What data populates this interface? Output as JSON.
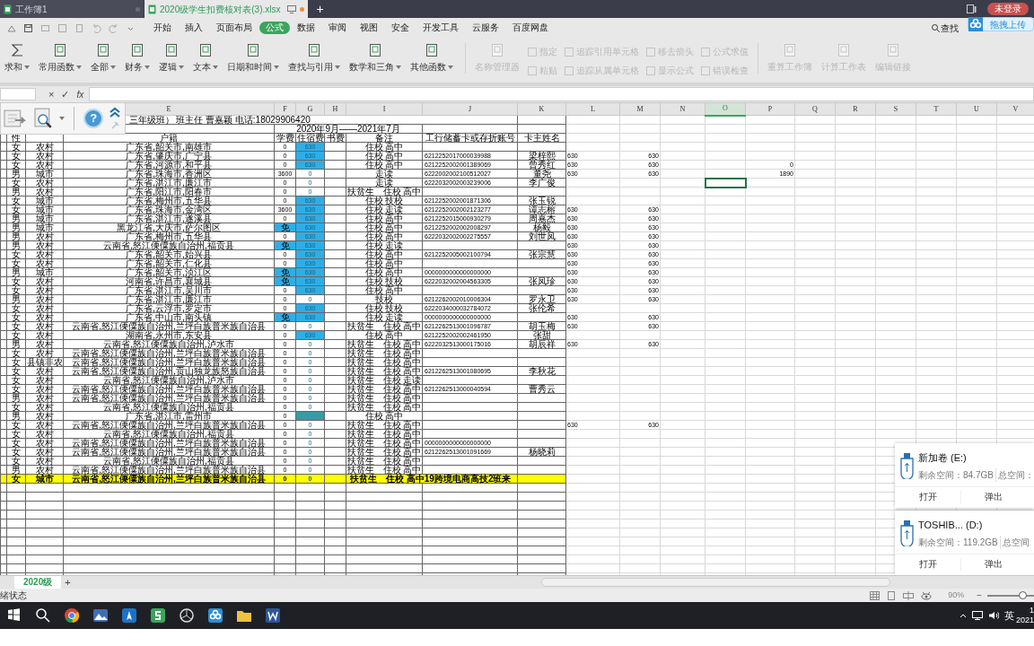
{
  "title_bar": {
    "tabs": [
      {
        "label": "工作簿1",
        "selected": false
      },
      {
        "label": "2020级学生扣费核对表(3).xlsx",
        "selected": true
      }
    ],
    "new_tab": "+",
    "login": "未登录"
  },
  "upload_tip": "拖拽上传",
  "menu": [
    {
      "label": "开始",
      "selected": false
    },
    {
      "label": "插入",
      "selected": false
    },
    {
      "label": "页面布局",
      "selected": false
    },
    {
      "label": "公式",
      "selected": true
    },
    {
      "label": "数据",
      "selected": false
    },
    {
      "label": "审阅",
      "selected": false
    },
    {
      "label": "视图",
      "selected": false
    },
    {
      "label": "安全",
      "selected": false
    },
    {
      "label": "开发工具",
      "selected": false
    },
    {
      "label": "云服务",
      "selected": false
    },
    {
      "label": "百度网盘",
      "selected": false
    }
  ],
  "search": "查找",
  "ribbon": [
    {
      "kind": "big",
      "label": "求和",
      "disabled": false,
      "dropdown": true
    },
    {
      "kind": "big",
      "label": "常用函数",
      "disabled": false,
      "dropdown": true
    },
    {
      "kind": "big",
      "label": "全部",
      "disabled": false,
      "dropdown": true
    },
    {
      "kind": "big",
      "label": "财务",
      "disabled": false,
      "dropdown": true
    },
    {
      "kind": "big",
      "label": "逻辑",
      "disabled": false,
      "dropdown": true
    },
    {
      "kind": "big",
      "label": "文本",
      "disabled": false,
      "dropdown": true
    },
    {
      "kind": "big",
      "label": "日期和时间",
      "disabled": false,
      "dropdown": true
    },
    {
      "kind": "big",
      "label": "查找与引用",
      "disabled": false,
      "dropdown": true
    },
    {
      "kind": "big",
      "label": "数学和三角",
      "disabled": false,
      "dropdown": true
    },
    {
      "kind": "big",
      "label": "其他函数",
      "disabled": false,
      "dropdown": true
    },
    {
      "kind": "big",
      "label": "名称管理器",
      "disabled": true,
      "dropdown": false
    },
    {
      "kind": "stack",
      "items": [
        {
          "label": "指定",
          "disabled": true
        },
        {
          "label": "粘贴",
          "disabled": true
        }
      ]
    },
    {
      "kind": "stack",
      "items": [
        {
          "label": "追踪引用单元格",
          "disabled": true
        },
        {
          "label": "追踪从属单元格",
          "disabled": true
        }
      ]
    },
    {
      "kind": "stack",
      "items": [
        {
          "label": "移去箭头",
          "disabled": true
        },
        {
          "label": "显示公式",
          "disabled": true
        }
      ]
    },
    {
      "kind": "stack",
      "items": [
        {
          "label": "公式求值",
          "disabled": true
        },
        {
          "label": "错误检查",
          "disabled": true
        }
      ]
    },
    {
      "kind": "big",
      "label": "重算工作簿",
      "disabled": true,
      "dropdown": false
    },
    {
      "kind": "big",
      "label": "计算工作表",
      "disabled": true,
      "dropdown": false
    },
    {
      "kind": "big",
      "label": "编辑链接",
      "disabled": true,
      "dropdown": false
    }
  ],
  "formula_bar": {
    "cancel": "×",
    "confirm": "✓",
    "function": "fx"
  },
  "help_glyph": "?",
  "sheet": {
    "columns": [
      {
        "label": "E",
        "selected": false
      },
      {
        "label": "F",
        "selected": false
      },
      {
        "label": "G",
        "selected": false
      },
      {
        "label": "H",
        "selected": false
      },
      {
        "label": "I",
        "selected": false
      },
      {
        "label": "J",
        "selected": false
      },
      {
        "label": "K",
        "selected": false
      },
      {
        "label": "L",
        "selected": false
      },
      {
        "label": "M",
        "selected": false
      },
      {
        "label": "N",
        "selected": false
      },
      {
        "label": "O",
        "selected": true
      },
      {
        "label": "P",
        "selected": false
      },
      {
        "label": "Q",
        "selected": false
      },
      {
        "label": "R",
        "selected": false
      },
      {
        "label": "S",
        "selected": false
      },
      {
        "label": "T",
        "selected": false
      },
      {
        "label": "U",
        "selected": false
      },
      {
        "label": "V",
        "selected": false
      }
    ],
    "title_line": "三年级班）  班主任 曹嘉颖 电话:18029906420",
    "period": "2020年9月——2021年7月",
    "headers": {
      "gender": "性",
      "address": "户籍",
      "tuition": "学费",
      "board": "住宿费",
      "books": "书费",
      "note": "备注",
      "account": "工行储蓄卡或存折账号",
      "holder": "卡主姓名"
    },
    "rows": [
      {
        "gender": "女",
        "area": "农村",
        "address": "广东省,韶关市,南雄市",
        "tuition": "0",
        "board": "630",
        "board_fill": {
          "color": "#2eaee6"
        },
        "note": "住校 高中"
      },
      {
        "gender": "女",
        "area": "农村",
        "address": "广东省,肇庆市,广宁县",
        "tuition": "0",
        "board": "630",
        "board_fill": {
          "color": "#2eaee6"
        },
        "note": "住校 高中",
        "account": "6212252017000039988",
        "holder": "梁梓熙",
        "l": "630",
        "m": "630"
      },
      {
        "gender": "女",
        "area": "农村",
        "address": "广东省,河源市,和平县",
        "tuition": "0",
        "board": "630",
        "board_fill": {
          "color": "#2eaee6"
        },
        "note": "住校 高中",
        "account": "6212252002001389069",
        "holder": "曾秀红",
        "l": "630",
        "m": "630",
        "p": "0"
      },
      {
        "gender": "男",
        "area": "城市",
        "address": "广东省,珠海市,香洲区",
        "tuition": "3600",
        "board": "0",
        "note": "走读",
        "account": "6222002002100512027",
        "holder": "董尧",
        "l": "630",
        "m": "630",
        "p": "1890"
      },
      {
        "gender": "女",
        "area": "农村",
        "address": "广东省,湛江市,廉江市",
        "tuition": "0",
        "board": "0",
        "note": "走读",
        "account": "6222032002003239006",
        "holder": "李广俊",
        "active_cell": true
      },
      {
        "gender": "男",
        "area": "农村",
        "address": "广东省,阳江市,阳春市",
        "tuition": "0",
        "board": "0",
        "note": "扶贫生　住校 高中"
      },
      {
        "gender": "女",
        "area": "城市",
        "address": "广东省,梅州市,五华县",
        "tuition": "0",
        "board": "630",
        "board_fill": {
          "color": "#2eaee6"
        },
        "note": "住校 技校",
        "account": "6212252002001871306",
        "holder": "张玉锐"
      },
      {
        "gender": "女",
        "area": "城市",
        "address": "广东省,珠海市,金湾区",
        "tuition": "3600",
        "board": "630",
        "board_fill": {
          "color": "#2eaee6"
        },
        "note": "住校 走读",
        "account": "6212252002002123277",
        "holder": "谭志榕",
        "l": "630",
        "m": "630"
      },
      {
        "gender": "男",
        "area": "城市",
        "address": "广东省,湛江市,遂溪县",
        "tuition": "0",
        "board": "630",
        "board_fill": {
          "color": "#2eaee6"
        },
        "note": "住校 高中",
        "account": "6212252015000930279",
        "holder": "周嘉杰",
        "l": "630",
        "m": "630"
      },
      {
        "gender": "男",
        "area": "城市",
        "address": "黑龙江省,大庆市,萨尔图区",
        "tuition": "免",
        "tuition_fill": {
          "color": "#2eaee6"
        },
        "board": "630",
        "board_fill": {
          "color": "#2eaee6"
        },
        "note": "住校 高中",
        "account": "6212252002002008297",
        "holder": "杨毅",
        "l": "630",
        "m": "630"
      },
      {
        "gender": "男",
        "area": "农村",
        "address": "广东省,梅州市,五华县",
        "tuition": "0",
        "board": "630",
        "board_fill": {
          "color": "#2eaee6"
        },
        "note": "住校 高中",
        "account": "6222032002002275557",
        "holder": "刘世凤",
        "l": "630",
        "m": "630"
      },
      {
        "gender": "男",
        "area": "农村",
        "address": "云南省,怒江傈僳族自治州,福贡县",
        "tuition": "免",
        "tuition_fill": {
          "color": "#2eaee6"
        },
        "board": "630",
        "board_fill": {
          "color": "#2eaee6"
        },
        "note": "住校 走读",
        "l": "630",
        "m": "630"
      },
      {
        "gender": "女",
        "area": "农村",
        "address": "广东省,韶关市,始兴县",
        "tuition": "0",
        "board": "630",
        "board_fill": {
          "color": "#2eaee6"
        },
        "note": "住校 高中",
        "account": "6212252005002100794",
        "holder": "张宗慧",
        "l": "630",
        "m": "630"
      },
      {
        "gender": "女",
        "area": "农村",
        "address": "广东省,韶关市,仁化县",
        "tuition": "0",
        "board": "630",
        "board_fill": {
          "color": "#2eaee6"
        },
        "note": "住校 高中",
        "l": "630",
        "m": "630"
      },
      {
        "gender": "男",
        "area": "城市",
        "address": "广东省,韶关市,浈江区",
        "tuition": "免",
        "tuition_fill": {
          "color": "#2eaee6"
        },
        "board": "630",
        "board_fill": {
          "color": "#2eaee6"
        },
        "note": "住校 高中",
        "account": "0000000000000000000",
        "l": "630",
        "m": "630"
      },
      {
        "gender": "女",
        "area": "农村",
        "address": "河南省,许昌市,襄城县",
        "tuition": "免",
        "tuition_fill": {
          "color": "#2eaee6"
        },
        "board": "630",
        "board_fill": {
          "color": "#2eaee6"
        },
        "note": "住校 技校",
        "account": "6222032002004563305",
        "holder": "张凤珍",
        "l": "630",
        "m": "630"
      },
      {
        "gender": "女",
        "area": "农村",
        "address": "广东省,湛江市,吴川市",
        "tuition": "0",
        "board": "630",
        "board_fill": {
          "color": "#2eaee6"
        },
        "note": "住校 高中",
        "l": "630",
        "m": "630"
      },
      {
        "gender": "男",
        "area": "农村",
        "address": "广东省,湛江市,廉江市",
        "tuition": "0",
        "board": "0",
        "note": "技校",
        "account": "6212262002010006304",
        "holder": "罗永卫",
        "l": "630",
        "m": "630"
      },
      {
        "gender": "女",
        "area": "农村",
        "address": "广东省,云浮市,罗定市",
        "tuition": "0",
        "board": "630",
        "board_fill": {
          "color": "#2eaee6"
        },
        "note": "住校 技校",
        "account": "6222034000032784072",
        "holder": "张伦希"
      },
      {
        "gender": "女",
        "area": "农村",
        "address": "广东省,中山市,南头镇",
        "tuition": "免",
        "tuition_fill": {
          "color": "#2eaee6"
        },
        "board": "630",
        "board_fill": {
          "color": "#2eaee6"
        },
        "note": "住校 走读",
        "account": "0000000000000000000",
        "l": "630",
        "m": "630"
      },
      {
        "gender": "女",
        "area": "农村",
        "address": "云南省,怒江傈僳族自治州,兰坪白族普米族自治县",
        "tuition": "0",
        "board": "0",
        "note": "扶贫生　住校 高中",
        "account": "6212262513001096787",
        "holder": "胡玉梅",
        "l": "630",
        "m": "630"
      },
      {
        "gender": "女",
        "area": "农村",
        "address": "湖南省,永州市,东安县",
        "tuition": "0",
        "board": "630",
        "board_fill": {
          "color": "#2eaee6"
        },
        "note": "住校 高中",
        "account": "6212252002002461950",
        "holder": "张甜"
      },
      {
        "gender": "男",
        "area": "农村",
        "address": "云南省,怒江傈僳族自治州,泸水市",
        "tuition": "0",
        "board": "0",
        "note": "扶贫生　住校 高中",
        "account": "6222032513000175016",
        "holder": "胡辰祥",
        "l": "630",
        "m": "630"
      },
      {
        "gender": "女",
        "area": "农村",
        "address": "云南省,怒江傈僳族自治州,兰坪白族普米族自治县",
        "tuition": "0",
        "board": "0",
        "note": "扶贫生　住校 高中"
      },
      {
        "gender": "女",
        "area": "县镇非农",
        "address": "云南省,怒江傈僳族自治州,兰坪白族普米族自治县",
        "tuition": "0",
        "board": "0",
        "note": "扶贫生　住校 高中"
      },
      {
        "gender": "女",
        "area": "农村",
        "address": "云南省,怒江傈僳族自治州,贡山独龙族怒族自治县",
        "tuition": "0",
        "board": "0",
        "note": "扶贫生　住校 高中",
        "account": "6212262513001080695",
        "holder": "李秋花"
      },
      {
        "gender": "女",
        "area": "农村",
        "address": "云南省,怒江傈僳族自治州,泸水市",
        "tuition": "0",
        "board": "0",
        "note": "扶贫生　住校 走读"
      },
      {
        "gender": "女",
        "area": "农村",
        "address": "云南省,怒江傈僳族自治州,兰坪白族普米族自治县",
        "tuition": "0",
        "board": "0",
        "note": "扶贫生　住校 高中",
        "account": "6212262513000040594",
        "holder": "曹秀云"
      },
      {
        "gender": "男",
        "area": "农村",
        "address": "云南省,怒江傈僳族自治州,兰坪白族普米族自治县",
        "tuition": "0",
        "board": "0",
        "note": "扶贫生　住校 高中"
      },
      {
        "gender": "女",
        "area": "农村",
        "address": "云南省,怒江傈僳族自治州,福贡县",
        "tuition": "0",
        "board": "0",
        "note": "扶贫生　住校 高中"
      },
      {
        "gender": "男",
        "area": "农村",
        "address": "广东省,湛江市,雷州市",
        "tuition": "0",
        "board_fill": {
          "color": "#3a9aa3"
        },
        "note": "住校 高中"
      },
      {
        "gender": "女",
        "area": "农村",
        "address": "云南省,怒江傈僳族自治州,兰坪白族普米族自治县",
        "tuition": "0",
        "board": "0",
        "note": "扶贫生　住校 高中",
        "l": "630",
        "m": "630"
      },
      {
        "gender": "女",
        "area": "农村",
        "address": "云南省,怒江傈僳族自治州,福贡县",
        "tuition": "0",
        "board": "0",
        "note": "扶贫生　住校 高中"
      },
      {
        "gender": "女",
        "area": "农村",
        "address": "云南省,怒江傈僳族自治州,兰坪白族普米族自治县",
        "tuition": "0",
        "board": "0",
        "note": "扶贫生　住校 高中",
        "account": "0000000000000000000"
      },
      {
        "gender": "女",
        "area": "农村",
        "address": "云南省,怒江傈僳族自治州,兰坪白族普米族自治县",
        "tuition": "0",
        "board": "0",
        "note": "扶贫生　住校 高中",
        "account": "6212262513001091669",
        "holder": "杨晓莉"
      },
      {
        "gender": "女",
        "area": "农村",
        "address": "云南省,怒江傈僳族自治州,福贡县",
        "tuition": "0",
        "board": "0",
        "note": "扶贫生　住校 高中"
      },
      {
        "gender": "男",
        "area": "农村",
        "address": "云南省,怒江傈僳族自治州,兰坪白族普米族自治县",
        "tuition": "0",
        "board": "0",
        "note": "扶贫生　住校 高中"
      },
      {
        "gender": "女",
        "area": "城市",
        "address": "云南省,怒江傈僳族自治州,兰坪白族普米族自治县",
        "tuition": "0",
        "board": "0",
        "note": "扶贫生　住校 高中19跨境电商高技2班来",
        "highlight": true
      }
    ]
  },
  "sheet_tabs": [
    {
      "label": "2020级",
      "selected": true
    }
  ],
  "add_sheet": "+",
  "status": "绪状态",
  "zoom": {
    "reading": "90%",
    "minus": "−",
    "level": 0.75
  },
  "drives": [
    {
      "name": "新加卷 (E:)",
      "free": "剩余空间：84.7GB",
      "total": "总空间：",
      "open": "打开",
      "eject": "弹出"
    },
    {
      "name": "TOSHIB...  (D:)",
      "free": "剩余空间：119.2GB",
      "total": "总空间",
      "open": "打开",
      "eject": "弹出"
    }
  ],
  "taskbar": {
    "ime": "英",
    "time": "1",
    "date": "2021"
  }
}
